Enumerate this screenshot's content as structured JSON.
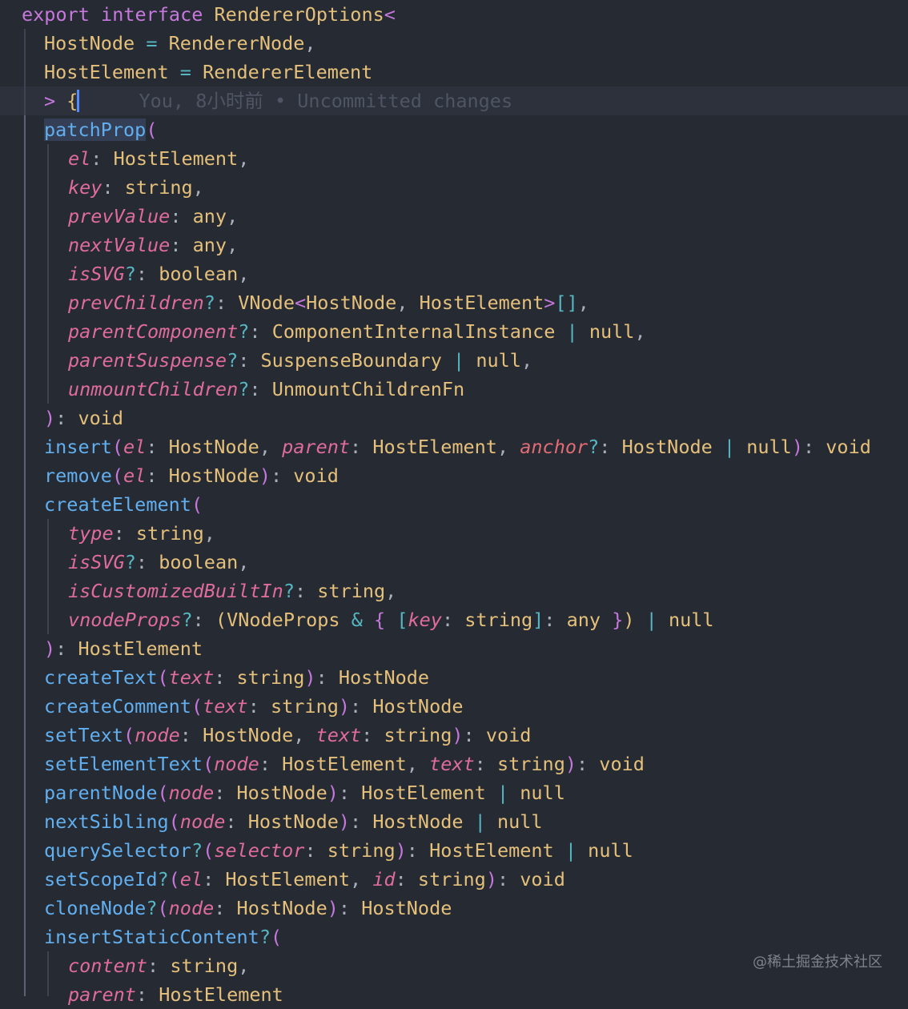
{
  "editor": {
    "blame": "You, 8小时前 • Uncommitted changes",
    "lines": [
      [
        [
          "export ",
          "kw"
        ],
        [
          "interface ",
          "kw"
        ],
        [
          "RendererOptions",
          "tp"
        ],
        [
          "<",
          "br1"
        ]
      ],
      [
        [
          "HostNode",
          "tp"
        ],
        [
          " = ",
          "op"
        ],
        [
          "RendererNode",
          "tp"
        ],
        [
          ",",
          "pn"
        ]
      ],
      [
        [
          "HostElement",
          "tp"
        ],
        [
          " = ",
          "op"
        ],
        [
          "RendererElement",
          "tp"
        ]
      ],
      [
        [
          "> ",
          "br1"
        ],
        [
          "{",
          "br2"
        ]
      ],
      [
        [
          "patchProp",
          "fn"
        ],
        [
          "(",
          "br1"
        ]
      ],
      [
        [
          "el",
          "pm"
        ],
        [
          ": ",
          "pn"
        ],
        [
          "HostElement",
          "tp"
        ],
        [
          ",",
          "pn"
        ]
      ],
      [
        [
          "key",
          "pm"
        ],
        [
          ": ",
          "pn"
        ],
        [
          "string",
          "tp"
        ],
        [
          ",",
          "pn"
        ]
      ],
      [
        [
          "prevValue",
          "pm"
        ],
        [
          ": ",
          "pn"
        ],
        [
          "any",
          "tp"
        ],
        [
          ",",
          "pn"
        ]
      ],
      [
        [
          "nextValue",
          "pm"
        ],
        [
          ": ",
          "pn"
        ],
        [
          "any",
          "tp"
        ],
        [
          ",",
          "pn"
        ]
      ],
      [
        [
          "isSVG",
          "pm"
        ],
        [
          "?",
          "op"
        ],
        [
          ": ",
          "pn"
        ],
        [
          "boolean",
          "tp"
        ],
        [
          ",",
          "pn"
        ]
      ],
      [
        [
          "prevChildren",
          "pm"
        ],
        [
          "?",
          "op"
        ],
        [
          ": ",
          "pn"
        ],
        [
          "VNode",
          "tp"
        ],
        [
          "<",
          "br1"
        ],
        [
          "HostNode",
          "tp"
        ],
        [
          ", ",
          "pn"
        ],
        [
          "HostElement",
          "tp"
        ],
        [
          ">",
          "br1"
        ],
        [
          "[]",
          "br3"
        ],
        [
          ",",
          "pn"
        ]
      ],
      [
        [
          "parentComponent",
          "pm"
        ],
        [
          "?",
          "op"
        ],
        [
          ": ",
          "pn"
        ],
        [
          "ComponentInternalInstance",
          "tp"
        ],
        [
          " | ",
          "op"
        ],
        [
          "null",
          "tp"
        ],
        [
          ",",
          "pn"
        ]
      ],
      [
        [
          "parentSuspense",
          "pm"
        ],
        [
          "?",
          "op"
        ],
        [
          ": ",
          "pn"
        ],
        [
          "SuspenseBoundary",
          "tp"
        ],
        [
          " | ",
          "op"
        ],
        [
          "null",
          "tp"
        ],
        [
          ",",
          "pn"
        ]
      ],
      [
        [
          "unmountChildren",
          "pm"
        ],
        [
          "?",
          "op"
        ],
        [
          ": ",
          "pn"
        ],
        [
          "UnmountChildrenFn",
          "tp"
        ]
      ],
      [
        [
          ")",
          "br1"
        ],
        [
          ": ",
          "pn"
        ],
        [
          "void",
          "tp"
        ]
      ],
      [
        [
          "insert",
          "fn"
        ],
        [
          "(",
          "br1"
        ],
        [
          "el",
          "pm"
        ],
        [
          ": ",
          "pn"
        ],
        [
          "HostNode",
          "tp"
        ],
        [
          ", ",
          "pn"
        ],
        [
          "parent",
          "pm"
        ],
        [
          ": ",
          "pn"
        ],
        [
          "HostElement",
          "tp"
        ],
        [
          ", ",
          "pn"
        ],
        [
          "anchor",
          "sq"
        ],
        [
          "?",
          "op"
        ],
        [
          ": ",
          "pn"
        ],
        [
          "HostNode",
          "tp"
        ],
        [
          " | ",
          "op"
        ],
        [
          "null",
          "tp"
        ],
        [
          ")",
          "br1"
        ],
        [
          ": ",
          "pn"
        ],
        [
          "void",
          "tp"
        ]
      ],
      [
        [
          "remove",
          "fn"
        ],
        [
          "(",
          "br1"
        ],
        [
          "el",
          "pm"
        ],
        [
          ": ",
          "pn"
        ],
        [
          "HostNode",
          "tp"
        ],
        [
          ")",
          "br1"
        ],
        [
          ": ",
          "pn"
        ],
        [
          "void",
          "tp"
        ]
      ],
      [
        [
          "createElement",
          "fn"
        ],
        [
          "(",
          "br1"
        ]
      ],
      [
        [
          "type",
          "pm"
        ],
        [
          ": ",
          "pn"
        ],
        [
          "string",
          "tp"
        ],
        [
          ",",
          "pn"
        ]
      ],
      [
        [
          "isSVG",
          "pm"
        ],
        [
          "?",
          "op"
        ],
        [
          ": ",
          "pn"
        ],
        [
          "boolean",
          "tp"
        ],
        [
          ",",
          "pn"
        ]
      ],
      [
        [
          "isCustomizedBuiltIn",
          "pm"
        ],
        [
          "?",
          "op"
        ],
        [
          ": ",
          "pn"
        ],
        [
          "string",
          "tp"
        ],
        [
          ",",
          "pn"
        ]
      ],
      [
        [
          "vnodeProps",
          "pm"
        ],
        [
          "?",
          "op"
        ],
        [
          ": ",
          "pn"
        ],
        [
          "(",
          "br2"
        ],
        [
          "VNodeProps",
          "tp"
        ],
        [
          " & ",
          "op"
        ],
        [
          "{",
          "br1"
        ],
        [
          " ",
          "tx"
        ],
        [
          "[",
          "br3"
        ],
        [
          "key",
          "pm"
        ],
        [
          ": ",
          "pn"
        ],
        [
          "string",
          "tp"
        ],
        [
          "]",
          "br3"
        ],
        [
          ": ",
          "pn"
        ],
        [
          "any",
          "tp"
        ],
        [
          " ",
          "tx"
        ],
        [
          "}",
          "br1"
        ],
        [
          ")",
          "br2"
        ],
        [
          " | ",
          "op"
        ],
        [
          "null",
          "tp"
        ]
      ],
      [
        [
          ")",
          "br1"
        ],
        [
          ": ",
          "pn"
        ],
        [
          "HostElement",
          "tp"
        ]
      ],
      [
        [
          "createText",
          "fn"
        ],
        [
          "(",
          "br1"
        ],
        [
          "text",
          "pm"
        ],
        [
          ": ",
          "pn"
        ],
        [
          "string",
          "tp"
        ],
        [
          ")",
          "br1"
        ],
        [
          ": ",
          "pn"
        ],
        [
          "HostNode",
          "tp"
        ]
      ],
      [
        [
          "createComment",
          "fn"
        ],
        [
          "(",
          "br1"
        ],
        [
          "text",
          "pm"
        ],
        [
          ": ",
          "pn"
        ],
        [
          "string",
          "tp"
        ],
        [
          ")",
          "br1"
        ],
        [
          ": ",
          "pn"
        ],
        [
          "HostNode",
          "tp"
        ]
      ],
      [
        [
          "setText",
          "fn"
        ],
        [
          "(",
          "br1"
        ],
        [
          "node",
          "pm"
        ],
        [
          ": ",
          "pn"
        ],
        [
          "HostNode",
          "tp"
        ],
        [
          ", ",
          "pn"
        ],
        [
          "text",
          "pm"
        ],
        [
          ": ",
          "pn"
        ],
        [
          "string",
          "tp"
        ],
        [
          ")",
          "br1"
        ],
        [
          ": ",
          "pn"
        ],
        [
          "void",
          "tp"
        ]
      ],
      [
        [
          "setElementText",
          "fn"
        ],
        [
          "(",
          "br1"
        ],
        [
          "node",
          "pm"
        ],
        [
          ": ",
          "pn"
        ],
        [
          "HostElement",
          "tp"
        ],
        [
          ", ",
          "pn"
        ],
        [
          "text",
          "pm"
        ],
        [
          ": ",
          "pn"
        ],
        [
          "string",
          "tp"
        ],
        [
          ")",
          "br1"
        ],
        [
          ": ",
          "pn"
        ],
        [
          "void",
          "tp"
        ]
      ],
      [
        [
          "parentNode",
          "fn"
        ],
        [
          "(",
          "br1"
        ],
        [
          "node",
          "pm"
        ],
        [
          ": ",
          "pn"
        ],
        [
          "HostNode",
          "tp"
        ],
        [
          ")",
          "br1"
        ],
        [
          ": ",
          "pn"
        ],
        [
          "HostElement",
          "tp"
        ],
        [
          " | ",
          "op"
        ],
        [
          "null",
          "tp"
        ]
      ],
      [
        [
          "nextSibling",
          "fn"
        ],
        [
          "(",
          "br1"
        ],
        [
          "node",
          "pm"
        ],
        [
          ": ",
          "pn"
        ],
        [
          "HostNode",
          "tp"
        ],
        [
          ")",
          "br1"
        ],
        [
          ": ",
          "pn"
        ],
        [
          "HostNode",
          "tp"
        ],
        [
          " | ",
          "op"
        ],
        [
          "null",
          "tp"
        ]
      ],
      [
        [
          "querySelector",
          "fn"
        ],
        [
          "?",
          "op"
        ],
        [
          "(",
          "br1"
        ],
        [
          "selector",
          "pm"
        ],
        [
          ": ",
          "pn"
        ],
        [
          "string",
          "tp"
        ],
        [
          ")",
          "br1"
        ],
        [
          ": ",
          "pn"
        ],
        [
          "HostElement",
          "tp"
        ],
        [
          " | ",
          "op"
        ],
        [
          "null",
          "tp"
        ]
      ],
      [
        [
          "setScopeId",
          "fn"
        ],
        [
          "?",
          "op"
        ],
        [
          "(",
          "br1"
        ],
        [
          "el",
          "pm"
        ],
        [
          ": ",
          "pn"
        ],
        [
          "HostElement",
          "tp"
        ],
        [
          ", ",
          "pn"
        ],
        [
          "id",
          "pm"
        ],
        [
          ": ",
          "pn"
        ],
        [
          "string",
          "tp"
        ],
        [
          ")",
          "br1"
        ],
        [
          ": ",
          "pn"
        ],
        [
          "void",
          "tp"
        ]
      ],
      [
        [
          "cloneNode",
          "fn"
        ],
        [
          "?",
          "op"
        ],
        [
          "(",
          "br1"
        ],
        [
          "node",
          "pm"
        ],
        [
          ": ",
          "pn"
        ],
        [
          "HostNode",
          "tp"
        ],
        [
          ")",
          "br1"
        ],
        [
          ": ",
          "pn"
        ],
        [
          "HostNode",
          "tp"
        ]
      ],
      [
        [
          "insertStaticContent",
          "fn"
        ],
        [
          "?",
          "op"
        ],
        [
          "(",
          "br1"
        ]
      ],
      [
        [
          "content",
          "pm"
        ],
        [
          ": ",
          "pn"
        ],
        [
          "string",
          "tp"
        ],
        [
          ",",
          "pn"
        ]
      ],
      [
        [
          "parent",
          "pm"
        ],
        [
          ": ",
          "pn"
        ],
        [
          "HostElement",
          "tp"
        ]
      ]
    ]
  },
  "watermark": "@稀土掘金技术社区"
}
